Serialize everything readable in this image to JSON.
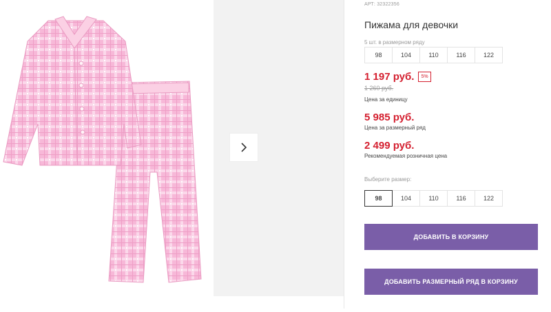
{
  "product": {
    "sku": "АРТ: 32322356",
    "title": "Пижама для девочки",
    "pack_label": "5 шт. в размерном ряду",
    "pack_sizes": [
      "98",
      "104",
      "110",
      "116",
      "122"
    ],
    "price": "1 197 руб.",
    "discount": "5%",
    "old_price": "1 260 руб.",
    "price_note": "Цена за единицу",
    "pack_price": "5 985 руб.",
    "pack_price_note": "Цена за размерный ряд",
    "rrp": "2 499 руб.",
    "rrp_note": "Рекомендуемая розничная цена",
    "choose_size_label": "Выберите размер:",
    "sizes": [
      "98",
      "104",
      "110",
      "116",
      "122"
    ],
    "selected_size": "98",
    "add_to_cart": "ДОБАВИТЬ В КОРЗИНУ",
    "add_pack_to_cart": "ДОБАВИТЬ РАЗМЕРНЫЙ РЯД В КОРЗИНУ"
  },
  "colors": {
    "accent": "#7a5ea8",
    "price": "#d41f2f",
    "pajama": "#f7b8d8"
  },
  "icons": {
    "next": "chevron-right-icon"
  }
}
